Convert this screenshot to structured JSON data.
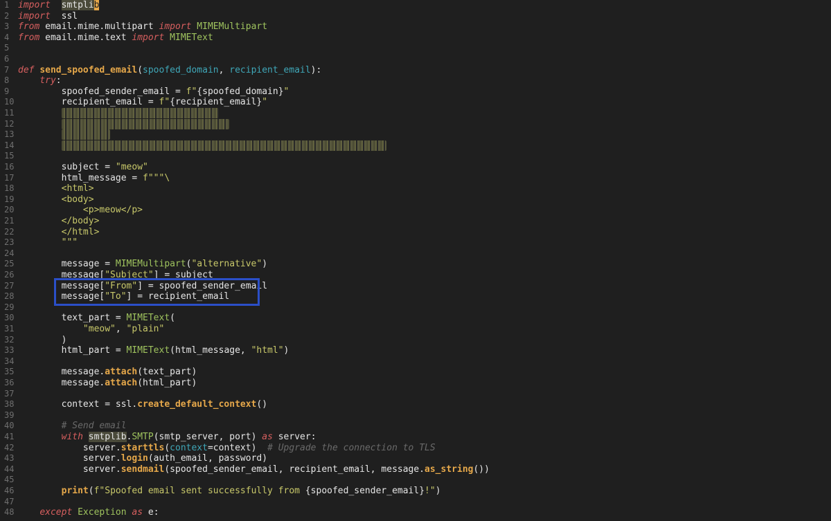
{
  "editor": {
    "language": "python",
    "colors": {
      "background": "#1f1f1f",
      "keyword": "#d75f5f",
      "string": "#c8c86a",
      "function": "#e6a84a",
      "class": "#9fc35e",
      "param": "#3fa7b8",
      "comment": "#6a6a6a",
      "highlight_box": "#2b4fc8"
    },
    "lines": [
      {
        "n": "1",
        "tokens": [
          [
            "kw",
            "import"
          ],
          [
            "",
            "  "
          ],
          [
            "hl",
            "smtpli"
          ],
          [
            "cursor",
            "b"
          ]
        ]
      },
      {
        "n": "2",
        "tokens": [
          [
            "kw",
            "import"
          ],
          [
            "",
            "  ssl"
          ]
        ]
      },
      {
        "n": "3",
        "tokens": [
          [
            "kw",
            "from"
          ],
          [
            "",
            " email.mime.multipart "
          ],
          [
            "kw",
            "import"
          ],
          [
            "",
            " "
          ],
          [
            "cls",
            "MIMEMultipart"
          ]
        ]
      },
      {
        "n": "4",
        "tokens": [
          [
            "kw",
            "from"
          ],
          [
            "",
            " email.mime.text "
          ],
          [
            "kw",
            "import"
          ],
          [
            "",
            " "
          ],
          [
            "cls",
            "MIMEText"
          ]
        ]
      },
      {
        "n": "5",
        "tokens": []
      },
      {
        "n": "6",
        "tokens": []
      },
      {
        "n": "7",
        "tokens": [
          [
            "kw",
            "def"
          ],
          [
            "",
            " "
          ],
          [
            "fn",
            "send_spoofed_email"
          ],
          [
            "",
            "("
          ],
          [
            "param",
            "spoofed_domain"
          ],
          [
            "",
            ", "
          ],
          [
            "param",
            "recipient_email"
          ],
          [
            "",
            "):"
          ]
        ]
      },
      {
        "n": "8",
        "tokens": [
          [
            "",
            "    "
          ],
          [
            "kw",
            "try"
          ],
          [
            "",
            ":"
          ]
        ]
      },
      {
        "n": "9",
        "tokens": [
          [
            "",
            "        spoofed_sender_email = "
          ],
          [
            "str",
            "f\""
          ],
          [
            "",
            "{spoofed_domain}"
          ],
          [
            "str",
            "\""
          ]
        ]
      },
      {
        "n": "10",
        "tokens": [
          [
            "",
            "        recipient_email = "
          ],
          [
            "str",
            "f\""
          ],
          [
            "",
            "{recipient_email}"
          ],
          [
            "str",
            "\""
          ]
        ]
      },
      {
        "n": "11",
        "tokens": [
          [
            "",
            "        "
          ],
          [
            "blur",
            "xxx xxxxx = \"xxxxxxxxxxxxxxx\""
          ]
        ]
      },
      {
        "n": "12",
        "tokens": [
          [
            "",
            "        "
          ],
          [
            "blur",
            "xxxx xxxxx = \"xxxxxxxxxxxxxxxx\""
          ]
        ]
      },
      {
        "n": "13",
        "tokens": [
          [
            "",
            "        "
          ],
          [
            "blur",
            "xxx = xxx"
          ]
        ]
      },
      {
        "n": "14",
        "tokens": [
          [
            "",
            "        "
          ],
          [
            "blur",
            "xxxxxxxxx = \"xxxxxxxxxxxxxxxxxxxxxxxxxxxxxxxxxxxxxxxxxxxxxx\""
          ]
        ]
      },
      {
        "n": "15",
        "tokens": []
      },
      {
        "n": "16",
        "tokens": [
          [
            "",
            "        subject = "
          ],
          [
            "str",
            "\"meow\""
          ]
        ]
      },
      {
        "n": "17",
        "tokens": [
          [
            "",
            "        html_message = "
          ],
          [
            "str",
            "f\"\"\"\\"
          ]
        ]
      },
      {
        "n": "18",
        "tokens": [
          [
            "str",
            "        <html>"
          ]
        ]
      },
      {
        "n": "19",
        "tokens": [
          [
            "str",
            "        <body>"
          ]
        ]
      },
      {
        "n": "20",
        "tokens": [
          [
            "str",
            "            <p>meow</p>"
          ]
        ]
      },
      {
        "n": "21",
        "tokens": [
          [
            "str",
            "        </body>"
          ]
        ]
      },
      {
        "n": "22",
        "tokens": [
          [
            "str",
            "        </html>"
          ]
        ]
      },
      {
        "n": "23",
        "tokens": [
          [
            "str",
            "        \"\"\""
          ]
        ]
      },
      {
        "n": "24",
        "tokens": []
      },
      {
        "n": "25",
        "tokens": [
          [
            "",
            "        message = "
          ],
          [
            "cls",
            "MIMEMultipart"
          ],
          [
            "",
            "("
          ],
          [
            "str",
            "\"alternative\""
          ],
          [
            "",
            ")"
          ]
        ]
      },
      {
        "n": "26",
        "tokens": [
          [
            "",
            "        message["
          ],
          [
            "str",
            "\"Subject\""
          ],
          [
            "",
            "] = subject"
          ]
        ]
      },
      {
        "n": "27",
        "tokens": [
          [
            "",
            "        message["
          ],
          [
            "str",
            "\"From\""
          ],
          [
            "",
            "] = spoofed_sender_email"
          ]
        ]
      },
      {
        "n": "28",
        "tokens": [
          [
            "",
            "        message["
          ],
          [
            "str",
            "\"To\""
          ],
          [
            "",
            "] = recipient_email"
          ]
        ]
      },
      {
        "n": "29",
        "tokens": []
      },
      {
        "n": "30",
        "tokens": [
          [
            "",
            "        text_part = "
          ],
          [
            "cls",
            "MIMEText"
          ],
          [
            "",
            "("
          ]
        ]
      },
      {
        "n": "31",
        "tokens": [
          [
            "",
            "            "
          ],
          [
            "str",
            "\"meow\""
          ],
          [
            "",
            ", "
          ],
          [
            "str",
            "\"plain\""
          ]
        ]
      },
      {
        "n": "32",
        "tokens": [
          [
            "",
            "        )"
          ]
        ]
      },
      {
        "n": "33",
        "tokens": [
          [
            "",
            "        html_part = "
          ],
          [
            "cls",
            "MIMEText"
          ],
          [
            "",
            "(html_message, "
          ],
          [
            "str",
            "\"html\""
          ],
          [
            "",
            ")"
          ]
        ]
      },
      {
        "n": "34",
        "tokens": []
      },
      {
        "n": "35",
        "tokens": [
          [
            "",
            "        message."
          ],
          [
            "fn",
            "attach"
          ],
          [
            "",
            "(text_part)"
          ]
        ]
      },
      {
        "n": "36",
        "tokens": [
          [
            "",
            "        message."
          ],
          [
            "fn",
            "attach"
          ],
          [
            "",
            "(html_part)"
          ]
        ]
      },
      {
        "n": "37",
        "tokens": []
      },
      {
        "n": "38",
        "tokens": [
          [
            "",
            "        context = ssl."
          ],
          [
            "fn",
            "create_default_context"
          ],
          [
            "",
            "()"
          ]
        ]
      },
      {
        "n": "39",
        "tokens": []
      },
      {
        "n": "40",
        "tokens": [
          [
            "cmt",
            "        # Send email"
          ]
        ]
      },
      {
        "n": "41",
        "tokens": [
          [
            "",
            "        "
          ],
          [
            "kw",
            "with"
          ],
          [
            "",
            " "
          ],
          [
            "hl",
            "smtplib"
          ],
          [
            "",
            "."
          ],
          [
            "cls",
            "SMTP"
          ],
          [
            "",
            "(smtp_server, port) "
          ],
          [
            "kw",
            "as"
          ],
          [
            "",
            " server:"
          ]
        ]
      },
      {
        "n": "42",
        "tokens": [
          [
            "",
            "            server."
          ],
          [
            "fn",
            "starttls"
          ],
          [
            "",
            "("
          ],
          [
            "param",
            "context"
          ],
          [
            "",
            "=context)  "
          ],
          [
            "cmt",
            "# Upgrade the connection to TLS"
          ]
        ]
      },
      {
        "n": "43",
        "tokens": [
          [
            "",
            "            server."
          ],
          [
            "fn",
            "login"
          ],
          [
            "",
            "(auth_email, password)"
          ]
        ]
      },
      {
        "n": "44",
        "tokens": [
          [
            "",
            "            server."
          ],
          [
            "fn",
            "sendmail"
          ],
          [
            "",
            "(spoofed_sender_email, recipient_email, message."
          ],
          [
            "fn",
            "as_string"
          ],
          [
            "",
            "())"
          ]
        ]
      },
      {
        "n": "45",
        "tokens": []
      },
      {
        "n": "46",
        "tokens": [
          [
            "",
            "        "
          ],
          [
            "fn",
            "print"
          ],
          [
            "",
            "("
          ],
          [
            "str",
            "f\"Spoofed email sent successfully from "
          ],
          [
            "",
            "{spoofed_sender_email}"
          ],
          [
            "str",
            "!\""
          ],
          [
            "",
            ")"
          ]
        ]
      },
      {
        "n": "47",
        "tokens": []
      },
      {
        "n": "48",
        "tokens": [
          [
            "",
            "    "
          ],
          [
            "kw",
            "except"
          ],
          [
            "",
            " "
          ],
          [
            "cls",
            "Exception"
          ],
          [
            "",
            " "
          ],
          [
            "kw",
            "as"
          ],
          [
            "",
            " e:"
          ]
        ]
      }
    ]
  }
}
